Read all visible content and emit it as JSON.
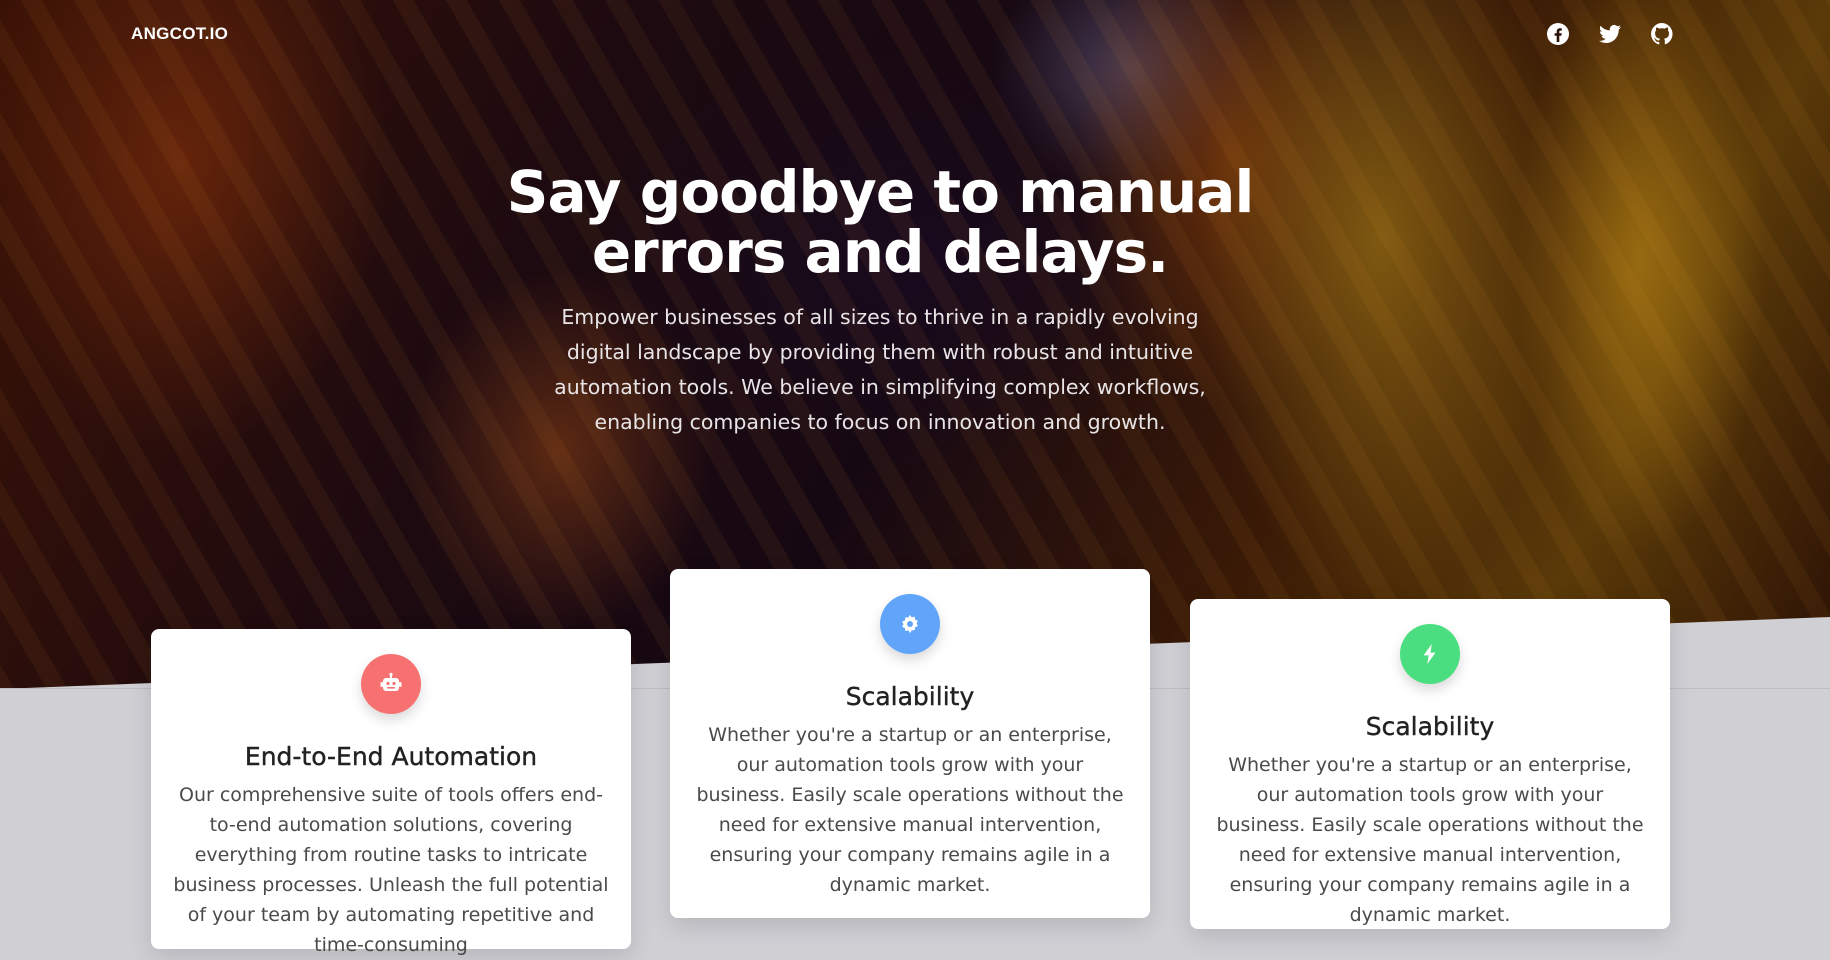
{
  "nav": {
    "brand": "ANGCOT.IO",
    "socials": [
      {
        "icon": "facebook-icon"
      },
      {
        "icon": "twitter-icon"
      },
      {
        "icon": "github-icon"
      }
    ]
  },
  "hero": {
    "headline": "Say goodbye to manual errors and delays.",
    "lead": "Empower businesses of all sizes to thrive in a rapidly evolving digital landscape by providing them with robust and intuitive automation tools. We believe in simplifying complex workflows, enabling companies to focus on innovation and growth."
  },
  "features": [
    {
      "icon": "robot-icon",
      "color": "#f87171",
      "title": "End-to-End Automation",
      "text": "Our comprehensive suite of tools offers end-to-end automation solutions, covering everything from routine tasks to intricate business processes. Unleash the full potential of your team by automating repetitive and time-consuming"
    },
    {
      "icon": "gear-icon",
      "color": "#60a5fa",
      "title": "Scalability",
      "text": "Whether you're a startup or an enterprise, our automation tools grow with your business. Easily scale operations without the need for extensive manual intervention, ensuring your company remains agile in a dynamic market."
    },
    {
      "icon": "bolt-icon",
      "color": "#4ade80",
      "title": "Scalability",
      "text": "Whether you're a startup or an enterprise, our automation tools grow with your business. Easily scale operations without the need for extensive manual intervention, ensuring your company remains agile in a dynamic market."
    }
  ]
}
